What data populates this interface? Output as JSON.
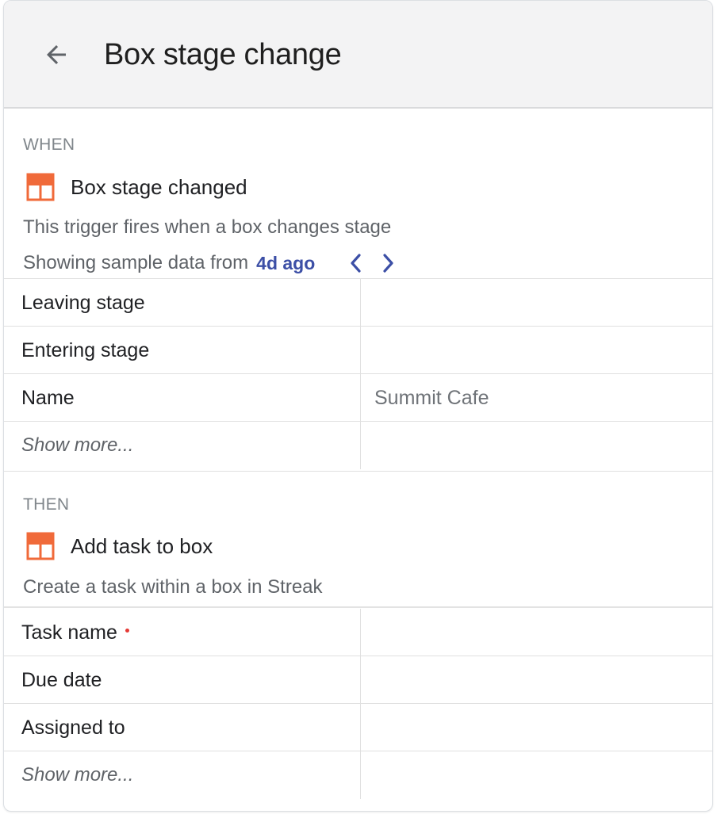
{
  "header": {
    "title": "Box stage change"
  },
  "trigger": {
    "section_label": "WHEN",
    "app_title": "Box stage changed",
    "description": "This trigger fires when a box changes stage",
    "sample_prefix": "Showing sample data from",
    "sample_link": "4d ago",
    "fields": [
      {
        "label": "Leaving stage",
        "value": ""
      },
      {
        "label": "Entering stage",
        "value": ""
      },
      {
        "label": "Name",
        "value": "Summit Cafe"
      }
    ],
    "show_more": "Show more..."
  },
  "action": {
    "section_label": "THEN",
    "app_title": "Add task to box",
    "description": "Create a task within a box in Streak",
    "fields": [
      {
        "label": "Task name",
        "value": "",
        "required": true
      },
      {
        "label": "Due date",
        "value": ""
      },
      {
        "label": "Assigned to",
        "value": ""
      }
    ],
    "show_more": "Show more..."
  },
  "colors": {
    "app_icon": "#f06a3a",
    "link": "#3c4fa6",
    "required": "#e53935"
  },
  "icons": {
    "back": "arrow-left-icon",
    "app": "streak-box-icon",
    "prev": "chevron-left-icon",
    "next": "chevron-right-icon"
  }
}
